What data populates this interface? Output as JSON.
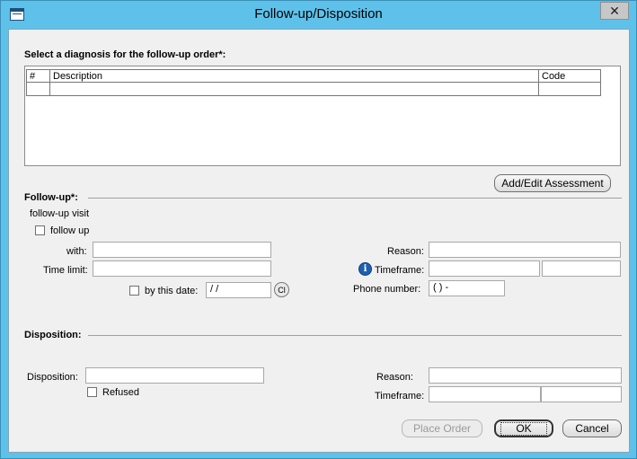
{
  "window": {
    "title": "Follow-up/Disposition",
    "close_glyph": "✕"
  },
  "diagnosis": {
    "label": "Select a diagnosis for the follow-up order*:",
    "columns": [
      "#",
      "Description",
      "Code"
    ],
    "rows": [
      [
        "",
        "",
        ""
      ]
    ],
    "add_edit_label": "Add/Edit Assessment"
  },
  "followup": {
    "section_label": "Follow-up*:",
    "visit_label": "follow-up visit",
    "follow_up_checkbox_label": "follow up",
    "with_label": "with:",
    "with_value": "",
    "time_limit_label": "Time limit:",
    "time_limit_value": "",
    "by_this_date_label": "by this date:",
    "date_value": "  /  /",
    "clear_label": "Cl",
    "reason_label": "Reason:",
    "reason_value": "",
    "info_glyph": "i",
    "timeframe_label": "Timeframe:",
    "timeframe_value_1": "",
    "timeframe_value_2": "",
    "phone_label": "Phone number:",
    "phone_value": "(   )    -"
  },
  "disposition": {
    "section_label": "Disposition:",
    "disposition_label": "Disposition:",
    "disposition_value": "",
    "refused_label": "Refused",
    "reason_label": "Reason:",
    "reason_value": "",
    "timeframe_label": "Timeframe:",
    "timeframe_value_1": "",
    "timeframe_value_2": ""
  },
  "buttons": {
    "place_order": "Place Order",
    "ok": "OK",
    "cancel": "Cancel"
  }
}
